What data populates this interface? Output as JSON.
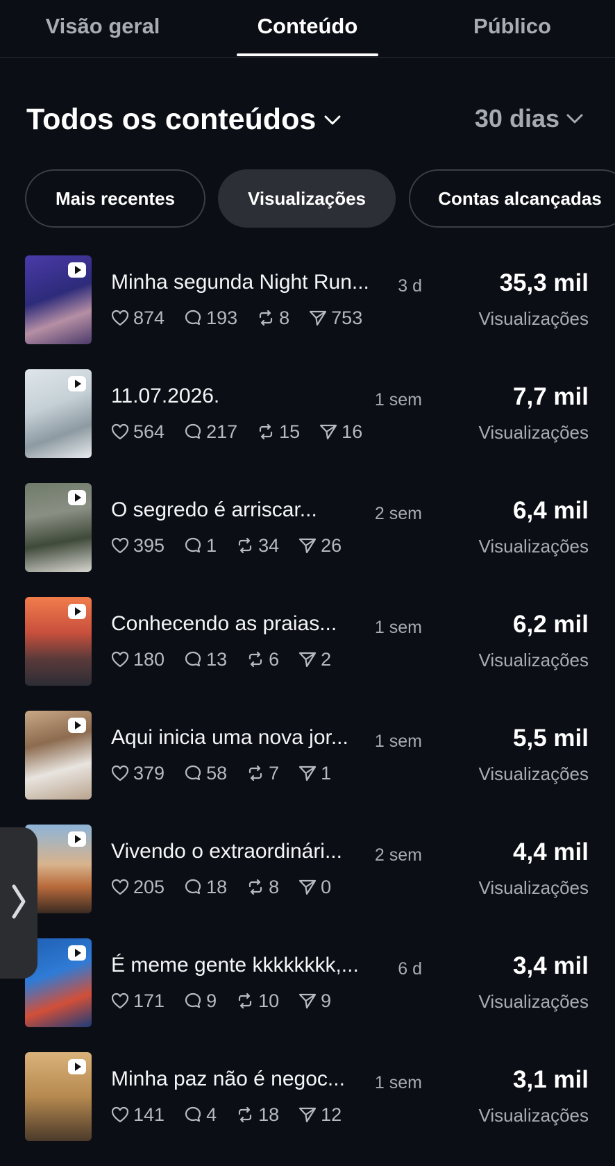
{
  "tabs": [
    {
      "label": "Visão geral"
    },
    {
      "label": "Conteúdo"
    },
    {
      "label": "Público"
    }
  ],
  "active_tab": "Conteúdo",
  "filter": {
    "title": "Todos os conteúdos",
    "range": "30 dias"
  },
  "chips": [
    {
      "label": "Mais recentes"
    },
    {
      "label": "Visualizações"
    },
    {
      "label": "Contas alcançadas"
    }
  ],
  "selected_chip": "Visualizações",
  "posts": [
    {
      "title": "Minha segunda Night Run...",
      "age": "3 d",
      "likes": "874",
      "comments": "193",
      "reposts": "8",
      "shares": "753",
      "metric": "35,3 mil",
      "metric_label": "Visualizações"
    },
    {
      "title": "11.07.2026.",
      "age": "1 sem",
      "likes": "564",
      "comments": "217",
      "reposts": "15",
      "shares": "16",
      "metric": "7,7 mil",
      "metric_label": "Visualizações"
    },
    {
      "title": "O segredo é arriscar...",
      "age": "2 sem",
      "likes": "395",
      "comments": "1",
      "reposts": "34",
      "shares": "26",
      "metric": "6,4 mil",
      "metric_label": "Visualizações"
    },
    {
      "title": "Conhecendo as praias...",
      "age": "1 sem",
      "likes": "180",
      "comments": "13",
      "reposts": "6",
      "shares": "2",
      "metric": "6,2 mil",
      "metric_label": "Visualizações"
    },
    {
      "title": "Aqui inicia uma nova jor...",
      "age": "1 sem",
      "likes": "379",
      "comments": "58",
      "reposts": "7",
      "shares": "1",
      "metric": "5,5 mil",
      "metric_label": "Visualizações"
    },
    {
      "title": "Vivendo o extraordinári...",
      "age": "2 sem",
      "likes": "205",
      "comments": "18",
      "reposts": "8",
      "shares": "0",
      "metric": "4,4 mil",
      "metric_label": "Visualizações"
    },
    {
      "title": "É meme gente kkkkkkkk,...",
      "age": "6 d",
      "likes": "171",
      "comments": "9",
      "reposts": "10",
      "shares": "9",
      "metric": "3,4 mil",
      "metric_label": "Visualizações"
    },
    {
      "title": "Minha paz não é negoc...",
      "age": "1 sem",
      "likes": "141",
      "comments": "4",
      "reposts": "18",
      "shares": "12",
      "metric": "3,1 mil",
      "metric_label": "Visualizações"
    }
  ],
  "colors": {
    "background": "#0b0e14",
    "text": "#ffffff",
    "muted": "#a8adb5",
    "chip_selected": "#2c2f36"
  },
  "icons": {
    "dropdown": "chevron-down-icon",
    "like": "heart-icon",
    "comment": "comment-icon",
    "repost": "repost-icon",
    "share": "share-icon",
    "video": "play-icon",
    "side": "chevron-right-icon"
  }
}
